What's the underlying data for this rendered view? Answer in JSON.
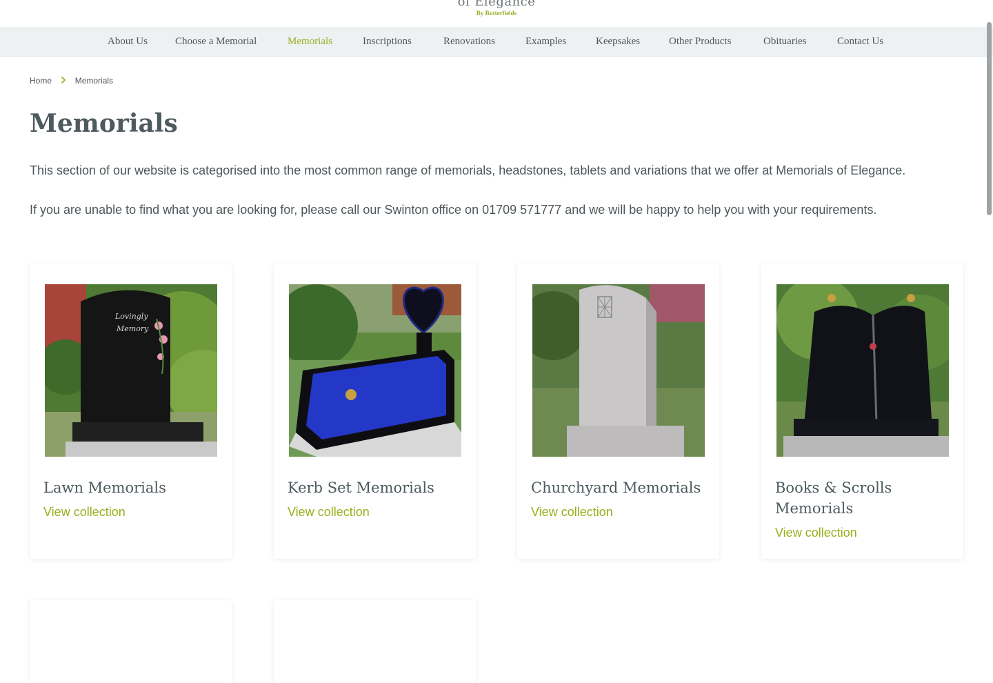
{
  "logo": {
    "title": "of Elegance",
    "subtitle": "By Butterfields"
  },
  "nav": {
    "items": [
      {
        "label": "About Us",
        "active": false
      },
      {
        "label": "Choose a Memorial",
        "active": false
      },
      {
        "label": "Memorials",
        "active": true
      },
      {
        "label": "Inscriptions",
        "active": false
      },
      {
        "label": "Renovations",
        "active": false
      },
      {
        "label": "Examples",
        "active": false
      },
      {
        "label": "Keepsakes",
        "active": false
      },
      {
        "label": "Other Products",
        "active": false
      },
      {
        "label": "Obituaries",
        "active": false
      },
      {
        "label": "Contact Us",
        "active": false
      }
    ]
  },
  "breadcrumb": {
    "home": "Home",
    "current": "Memorials"
  },
  "page": {
    "title": "Memorials",
    "intro1": "This section of our website is categorised into the most common range of memorials, headstones, tablets and variations that we offer at Memorials of Elegance.",
    "intro2": "If you are unable to find what you are looking for, please call our Swinton office on 01709 571777 and we will be happy to help you with your requirements."
  },
  "cards": [
    {
      "title": "Lawn Memorials",
      "link": "View collection",
      "icon": "lawn-headstone-image"
    },
    {
      "title": "Kerb Set Memorials",
      "link": "View collection",
      "icon": "kerb-set-image"
    },
    {
      "title": "Churchyard Memorials",
      "link": "View collection",
      "icon": "churchyard-headstone-image"
    },
    {
      "title": "Books & Scrolls Memorials",
      "link": "View collection",
      "icon": "book-memorial-image"
    }
  ],
  "colors": {
    "accent": "#9aae1c",
    "nav_bg": "#eef1f2",
    "heading": "#4d5a5e"
  }
}
